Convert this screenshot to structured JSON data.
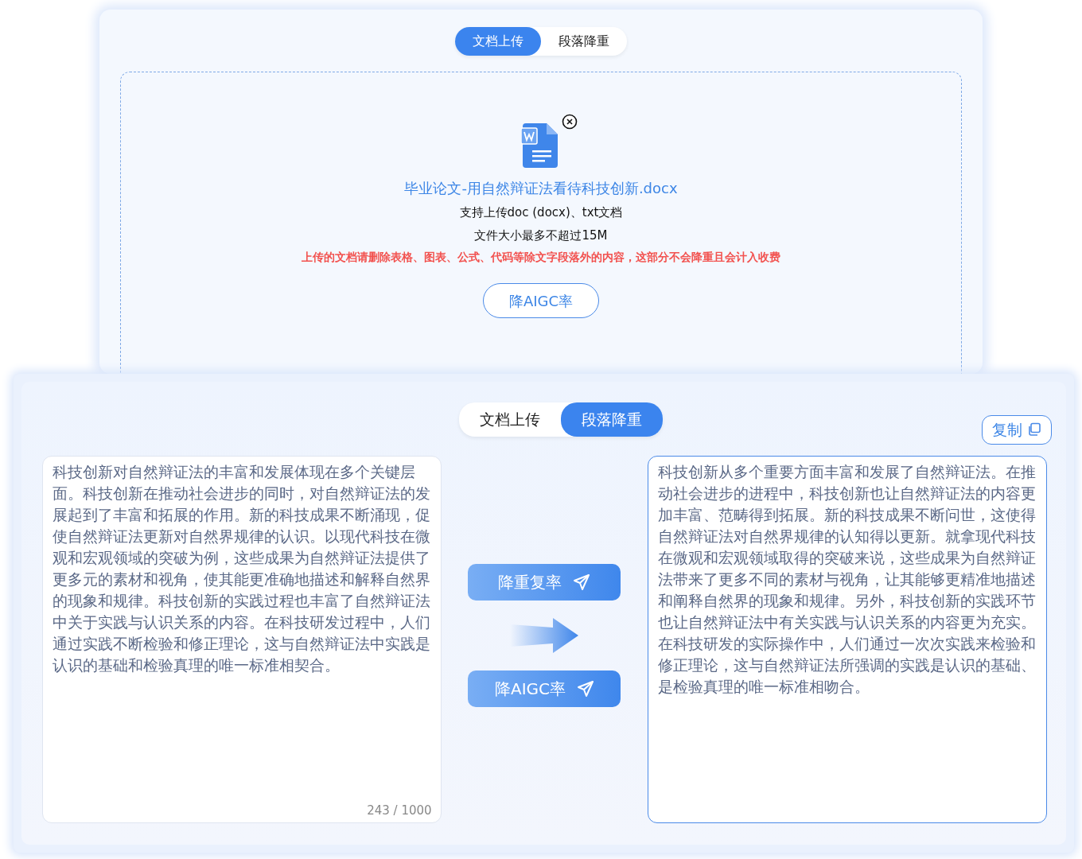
{
  "upload_panel": {
    "tabs": [
      {
        "label": "文档上传",
        "selected": true
      },
      {
        "label": "段落降重",
        "selected": false
      }
    ],
    "file": {
      "name": "毕业论文-用自然辩证法看待科技创新.docx"
    },
    "hints": [
      "支持上传doc (docx)、txt文档",
      "文件大小最多不超过15M"
    ],
    "warning": "上传的文档请删除表格、图表、公式、代码等除文字段落外的内容，这部分不会降重且会计入收费",
    "button": "降AIGC率"
  },
  "rewrite_panel": {
    "tabs": [
      {
        "label": "文档上传",
        "selected": false
      },
      {
        "label": "段落降重",
        "selected": true
      }
    ],
    "copy_button": "复制",
    "input": {
      "value": "科技创新对自然辩证法的丰富和发展体现在多个关键层面。科技创新在推动社会进步的同时，对自然辩证法的发展起到了丰富和拓展的作用。新的科技成果不断涌现，促使自然辩证法更新对自然界规律的认识。以现代科技在微观和宏观领域的突破为例，这些成果为自然辩证法提供了更多元的素材和视角，使其能更准确地描述和解释自然界的现象和规律。科技创新的实践过程也丰富了自然辩证法中关于实践与认识关系的内容。在科技研发过程中，人们通过实践不断检验和修正理论，这与自然辩证法中实践是认识的基础和检验真理的唯一标准相契合。",
      "counter": "243 / 1000"
    },
    "actions": [
      "降重复率",
      "降AIGC率"
    ],
    "output": {
      "text": "科技创新从多个重要方面丰富和发展了自然辩证法。在推动社会进步的进程中，科技创新也让自然辩证法的内容更加丰富、范畴得到拓展。新的科技成果不断问世，这使得自然辩证法对自然界规律的认知得以更新。就拿现代科技在微观和宏观领域取得的突破来说，这些成果为自然辩证法带来了更多不同的素材与视角，让其能够更精准地描述和阐释自然界的现象和规律。另外，科技创新的实践环节也让自然辩证法中有关实践与认识关系的内容更为充实。在科技研发的实际操作中，人们通过一次次实践来检验和修正理论，这与自然辩证法所强调的实践是认识的基础、是检验真理的唯一标准相吻合。"
    }
  }
}
